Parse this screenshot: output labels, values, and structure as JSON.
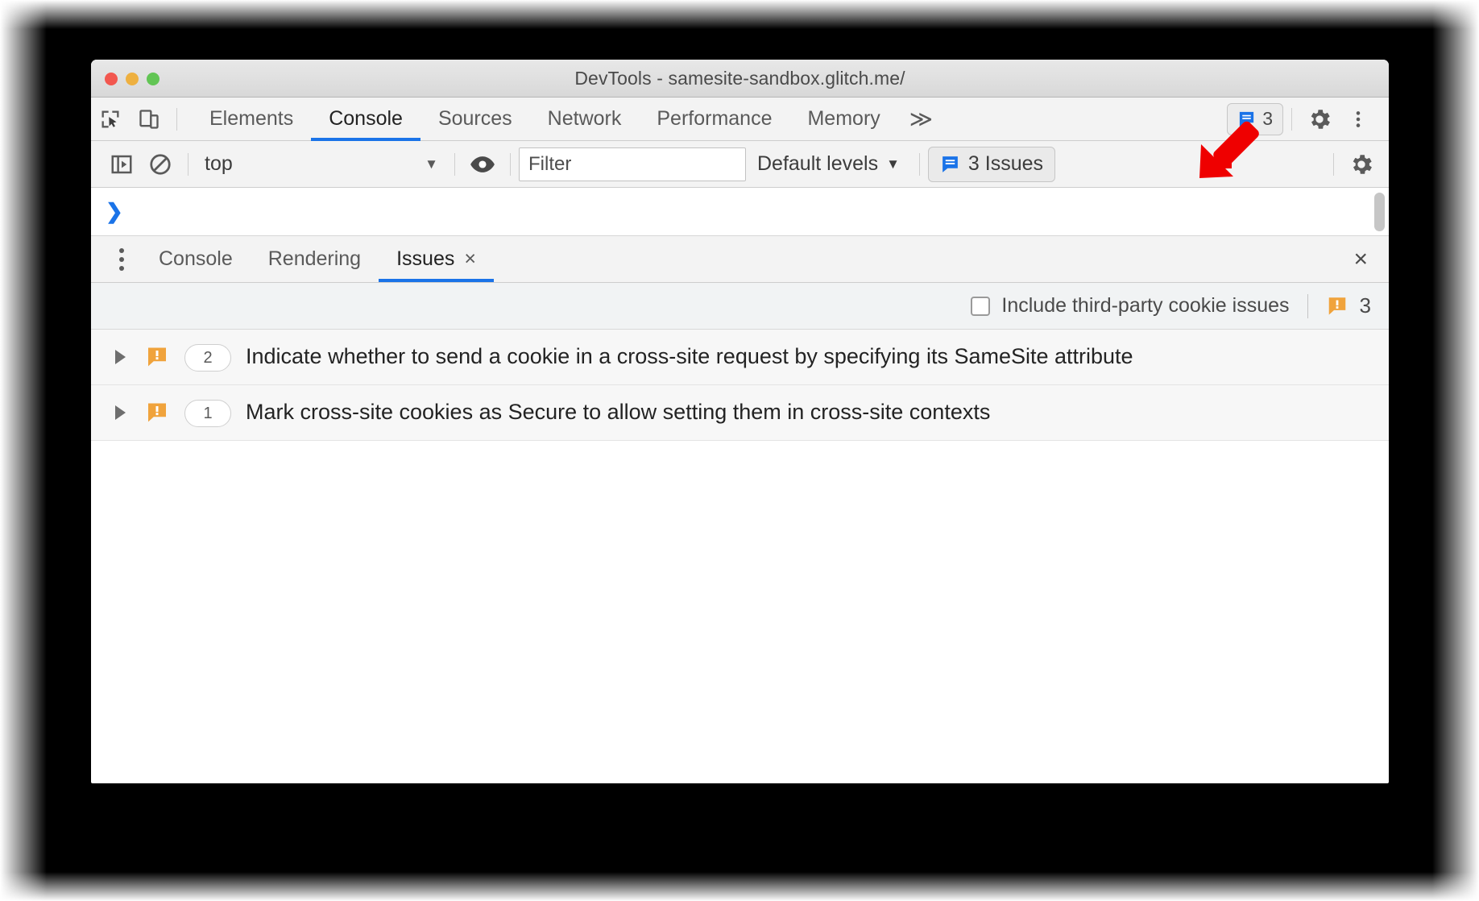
{
  "window": {
    "title": "DevTools - samesite-sandbox.glitch.me/",
    "traffic_lights": [
      "close-red",
      "minimize-yellow",
      "maximize-green"
    ]
  },
  "main_tabbar": {
    "inspect_icon": "inspect-element-icon",
    "device_icon": "device-toolbar-icon",
    "tabs": [
      {
        "label": "Elements",
        "active": false
      },
      {
        "label": "Console",
        "active": true
      },
      {
        "label": "Sources",
        "active": false
      },
      {
        "label": "Network",
        "active": false
      },
      {
        "label": "Performance",
        "active": false
      },
      {
        "label": "Memory",
        "active": false
      }
    ],
    "more_tabs_label": "≫",
    "issues_badge": {
      "icon": "issues-message-icon",
      "count": "3"
    },
    "settings_icon": "gear-icon",
    "more_icon": "kebab-menu-icon"
  },
  "console_toolbar": {
    "execute_icon": "show-console-sidebar-icon",
    "clear_icon": "clear-console-icon",
    "context": {
      "value": "top",
      "caret": "▼"
    },
    "eye_icon": "live-expression-eye-icon",
    "filter": {
      "value": "",
      "placeholder": "Filter"
    },
    "levels": {
      "label": "Default levels",
      "caret": "▼"
    },
    "issues_button": {
      "icon": "issues-message-icon",
      "label": "3 Issues"
    },
    "settings_icon": "gear-icon"
  },
  "console_prompt": {
    "chevron": "❯",
    "value": ""
  },
  "drawer": {
    "kebab_icon": "kebab-menu-icon",
    "tabs": [
      {
        "label": "Console",
        "active": false,
        "closable": false
      },
      {
        "label": "Rendering",
        "active": false,
        "closable": false
      },
      {
        "label": "Issues",
        "active": true,
        "closable": true,
        "close_glyph": "×"
      }
    ],
    "close_drawer_glyph": "×"
  },
  "issues_panel": {
    "third_party_checkbox": {
      "label": "Include third-party cookie issues",
      "checked": false
    },
    "summary": {
      "icon": "issue-warning-icon",
      "count": "3"
    },
    "rows": [
      {
        "disclosure": "collapsed",
        "icon": "issue-warning-icon",
        "count": "2",
        "text": "Indicate whether to send a cookie in a cross-site request by specifying its SameSite attribute"
      },
      {
        "disclosure": "collapsed",
        "icon": "issue-warning-icon",
        "count": "1",
        "text": "Mark cross-site cookies as Secure to allow setting them in cross-site contexts"
      }
    ]
  },
  "annotation": {
    "arrow": "red-arrow-pointing-down-left"
  },
  "colors": {
    "accent_blue": "#1a73e8",
    "issue_orange": "#f0a33c",
    "toolbar_bg": "#f3f3f3",
    "panel_bg": "#f1f3f4",
    "annotation_red": "#ef0000"
  }
}
